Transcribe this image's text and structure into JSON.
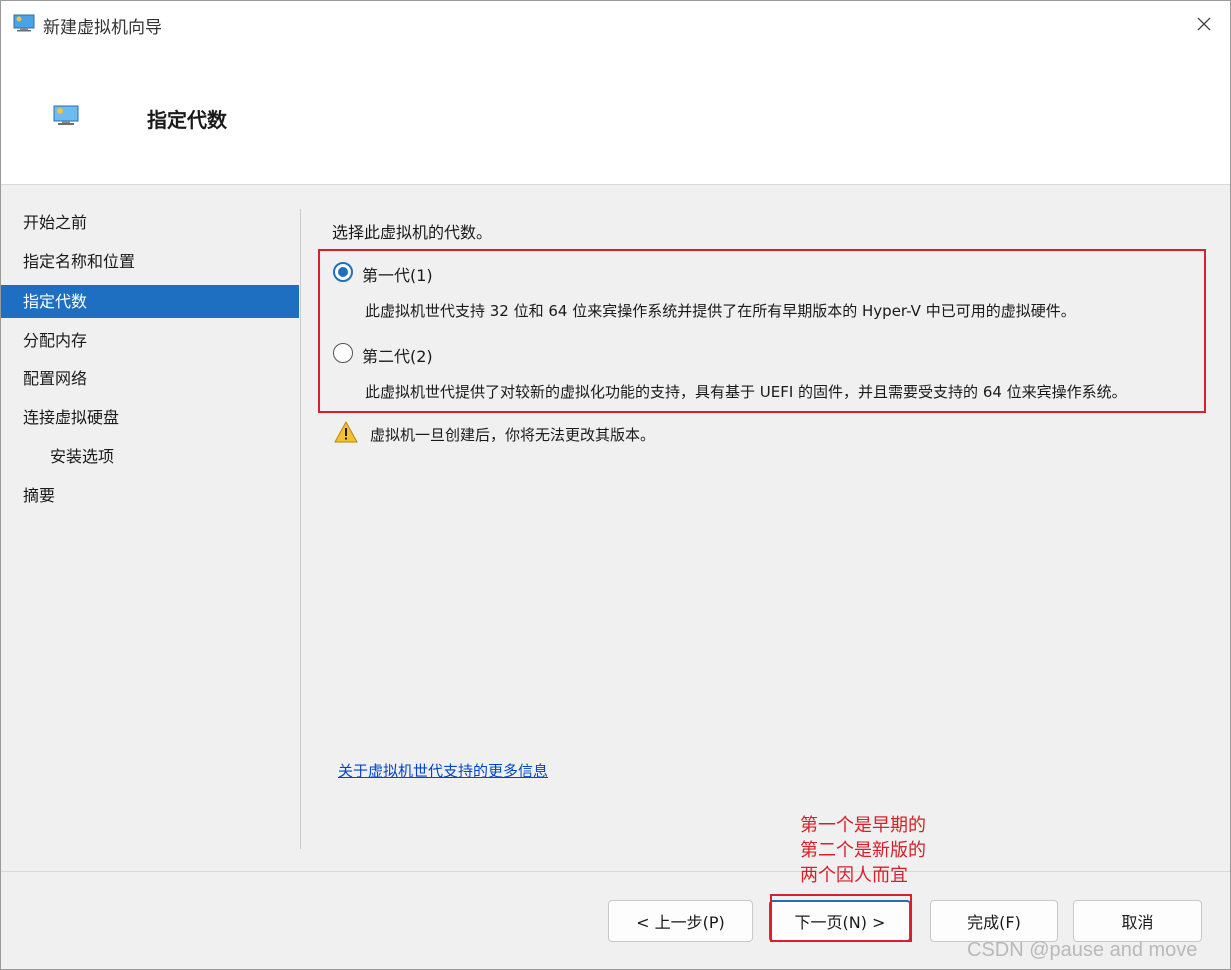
{
  "window": {
    "title": "新建虚拟机向导",
    "icon": "hyperv-monitor-icon"
  },
  "header": {
    "title": "指定代数",
    "icon": "hyperv-monitor-icon"
  },
  "sidebar": {
    "items": [
      {
        "label": "开始之前",
        "active": false,
        "sub": false
      },
      {
        "label": "指定名称和位置",
        "active": false,
        "sub": false
      },
      {
        "label": "指定代数",
        "active": true,
        "sub": false
      },
      {
        "label": "分配内存",
        "active": false,
        "sub": false
      },
      {
        "label": "配置网络",
        "active": false,
        "sub": false
      },
      {
        "label": "连接虚拟硬盘",
        "active": false,
        "sub": false
      },
      {
        "label": "安装选项",
        "active": false,
        "sub": true
      },
      {
        "label": "摘要",
        "active": false,
        "sub": false
      }
    ]
  },
  "main": {
    "intro": "选择此虚拟机的代数。",
    "options": [
      {
        "label": "第一代(1)",
        "checked": true,
        "description": "此虚拟机世代支持 32 位和 64 位来宾操作系统并提供了在所有早期版本的 Hyper-V 中已可用的虚拟硬件。"
      },
      {
        "label": "第二代(2)",
        "checked": false,
        "description": "此虚拟机世代提供了对较新的虚拟化功能的支持，具有基于 UEFI 的固件，并且需要受支持的 64 位来宾操作系统。"
      }
    ],
    "warning": "虚拟机一旦创建后，你将无法更改其版本。",
    "more_info_link": "关于虚拟机世代支持的更多信息"
  },
  "buttons": {
    "prev": "< 上一步(P)",
    "next": "下一页(N) >",
    "finish": "完成(F)",
    "cancel": "取消"
  },
  "annotation": {
    "lines": [
      "第一个是早期的",
      "第二个是新版的",
      "两个因人而宜"
    ]
  },
  "watermark": "CSDN @pause and move",
  "colors": {
    "accent": "#1e6fc2",
    "highlight": "#d9202a",
    "link": "#0044cc"
  }
}
